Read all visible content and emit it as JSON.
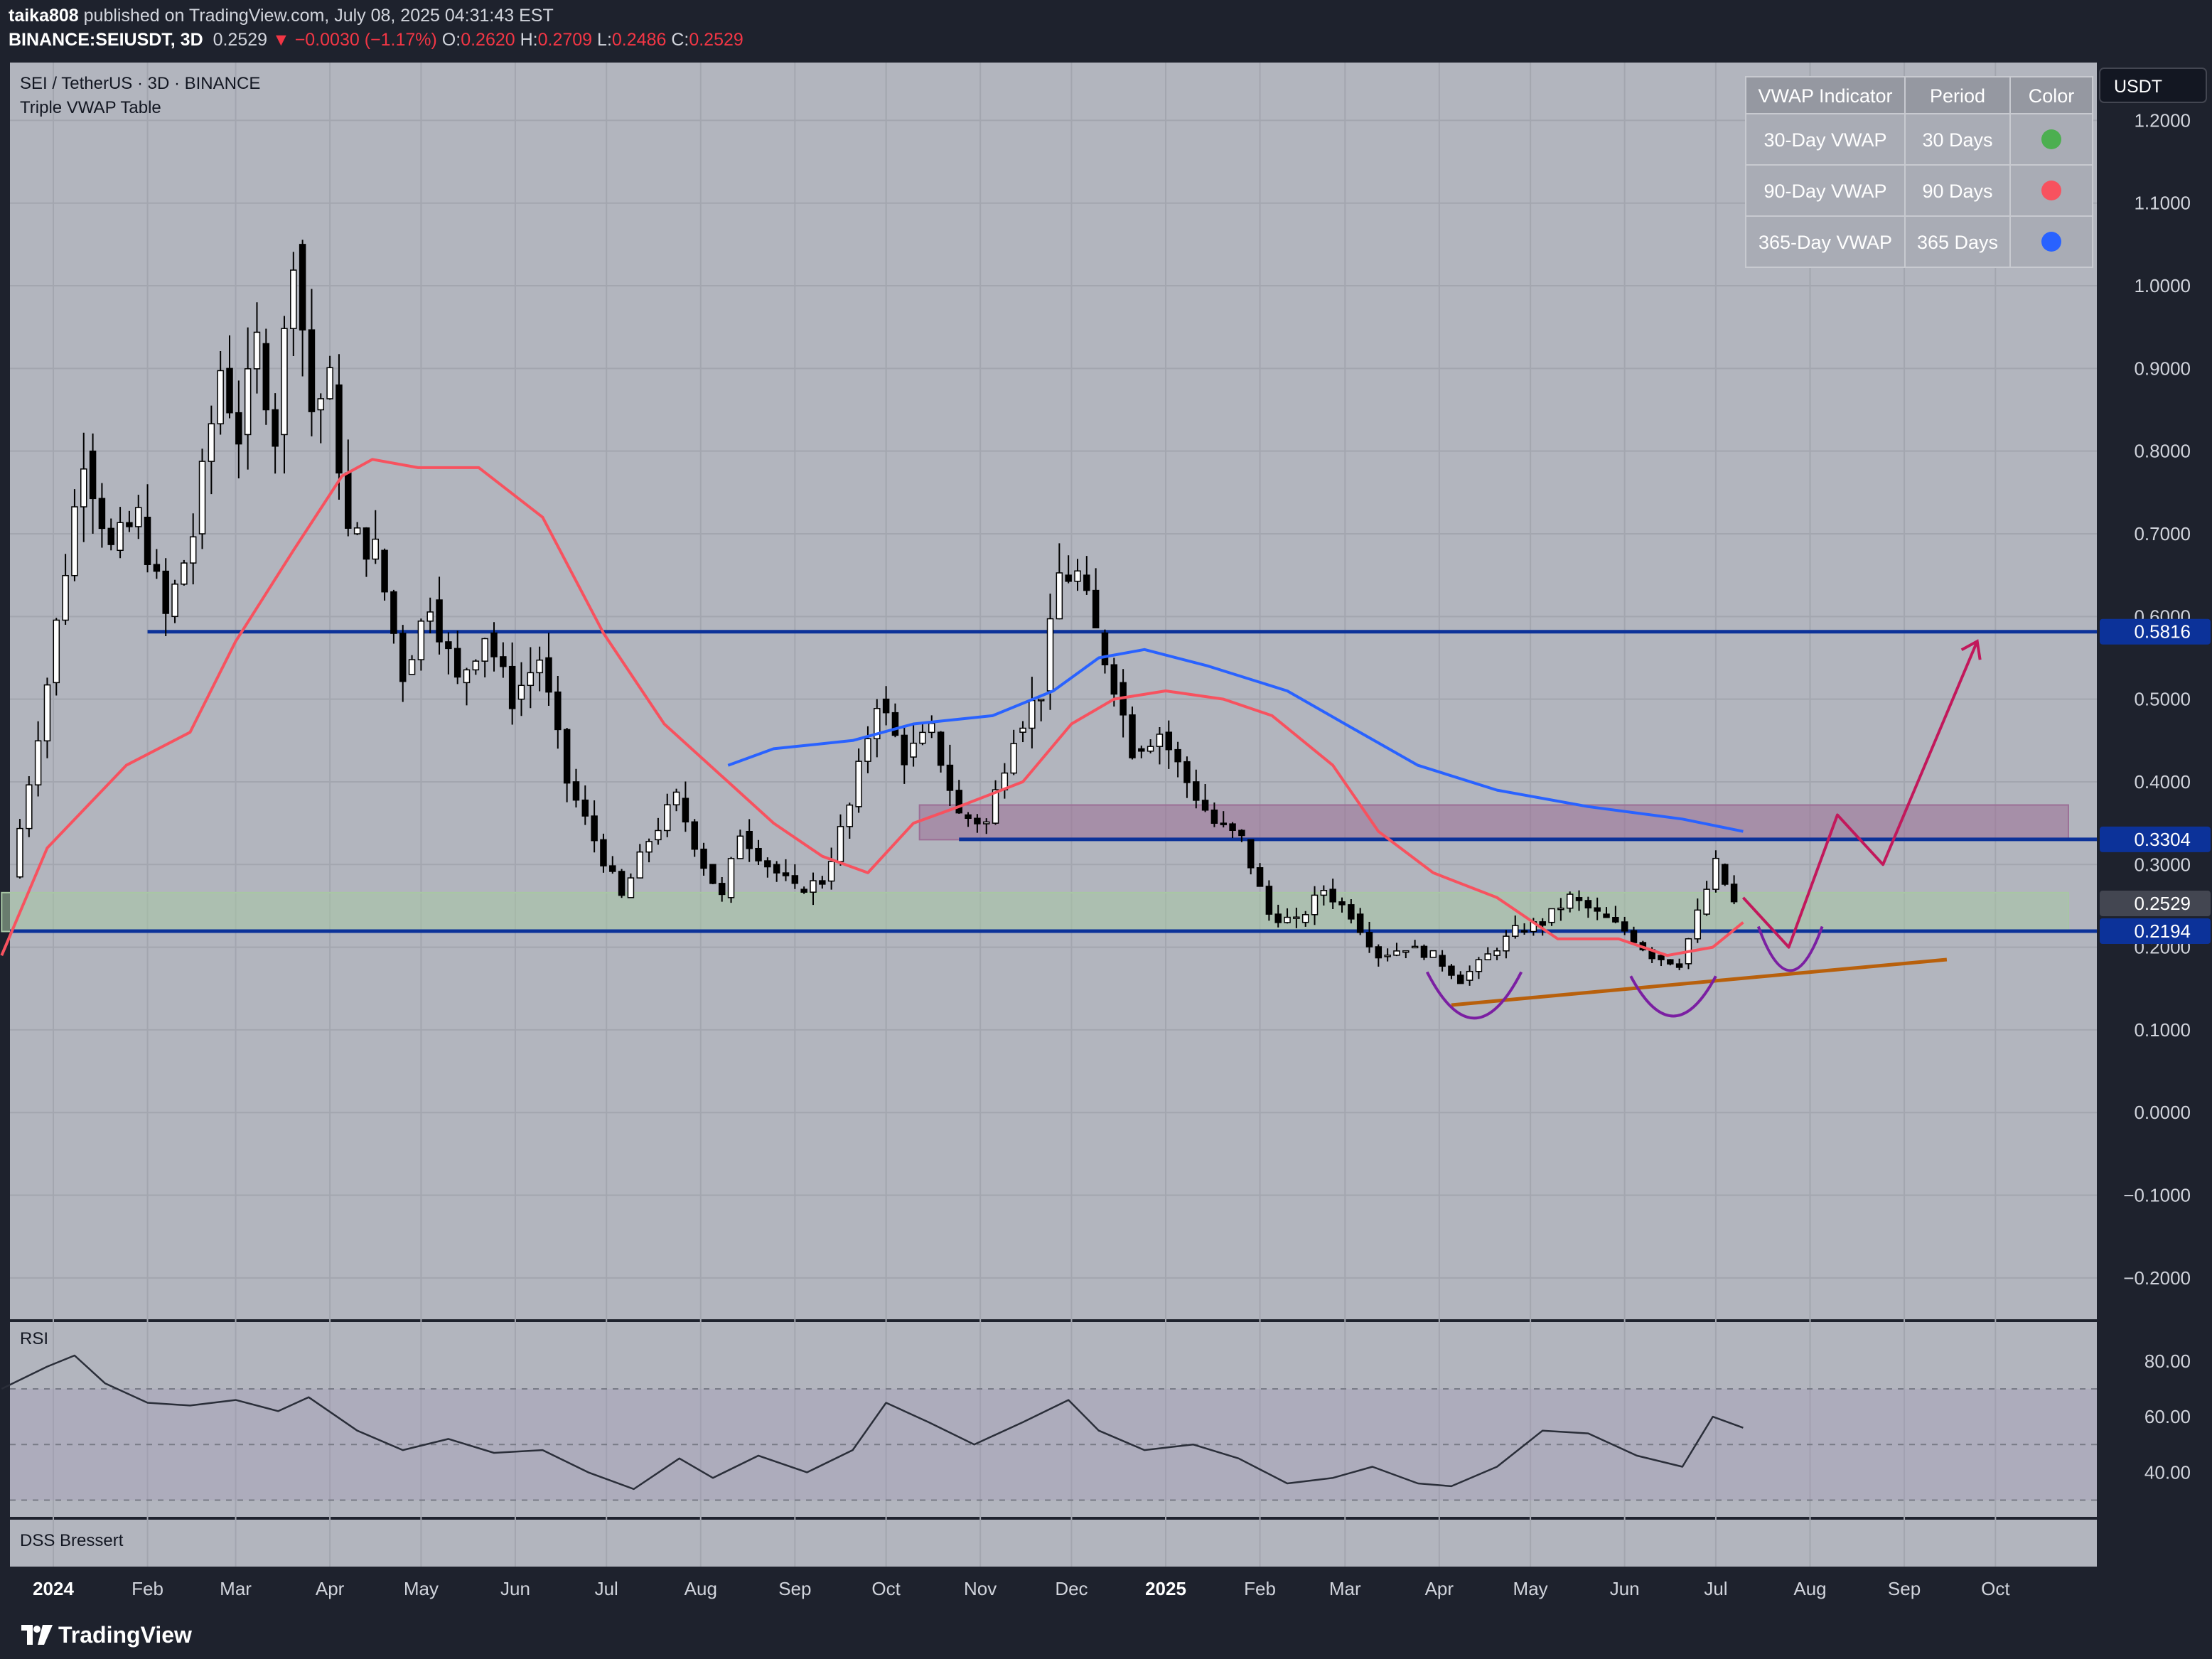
{
  "header": {
    "author": "taika808",
    "published_text": "published on TradingView.com, July 08, 2025 04:31:43 EST",
    "symbol": "BINANCE:SEIUSDT, 3D",
    "last": "0.2529",
    "change": "−0.0030 (−1.17%)",
    "o_label": "O:",
    "o_value": "0.2620",
    "h_label": "H:",
    "h_value": "0.2709",
    "l_label": "L:",
    "l_value": "0.2486",
    "c_label": "C:",
    "c_value": "0.2529"
  },
  "legend": {
    "symbol_title": "SEI / TetherUS · 3D · BINANCE",
    "indicator_title": "Triple VWAP Table",
    "rsi_title": "RSI",
    "dss_title": "DSS Bressert"
  },
  "vwap_table": {
    "headers": [
      "VWAP Indicator",
      "Period",
      "Color"
    ],
    "rows": [
      {
        "indicator": "30-Day VWAP",
        "period": "30 Days",
        "color": "#4caf50"
      },
      {
        "indicator": "90-Day VWAP",
        "period": "90 Days",
        "color": "#f7525f"
      },
      {
        "indicator": "365-Day VWAP",
        "period": "365 Days",
        "color": "#2962ff"
      }
    ]
  },
  "footer": {
    "brand": "TradingView"
  },
  "colors": {
    "pane_bg": "#b2b5be",
    "candle_body_up": "#ffffff",
    "candle_body_down": "#000000",
    "vwap90": "#f7525f",
    "vwap365": "#2962ff",
    "level_line": "#0c3299",
    "projection": "#c2185b",
    "cup": "#7b1fa2",
    "trendline": "#b8600c"
  },
  "chart_data": [
    {
      "type": "candlestick",
      "currency_label": "USDT",
      "y_ticks": [
        "1.2000",
        "1.1000",
        "1.0000",
        "0.9000",
        "0.8000",
        "0.7000",
        "0.6000",
        "0.5000",
        "0.4000",
        "0.3000",
        "0.2000",
        "0.1000",
        "0.0000",
        "−0.1000",
        "−0.2000"
      ],
      "y_range": [
        -0.25,
        1.27
      ],
      "x_labels": [
        "2024",
        "Feb",
        "Mar",
        "Apr",
        "May",
        "Jun",
        "Jul",
        "Aug",
        "Sep",
        "Oct",
        "Nov",
        "Dec",
        "2025",
        "Feb",
        "Mar",
        "Apr",
        "May",
        "Jun",
        "Jul",
        "Aug",
        "Sep",
        "Oct"
      ],
      "x_label_dates": [
        "2024-01-01",
        "2024-02-01",
        "2024-03-01",
        "2024-04-01",
        "2024-05-01",
        "2024-06-01",
        "2024-07-01",
        "2024-08-01",
        "2024-09-01",
        "2024-10-01",
        "2024-11-01",
        "2024-12-01",
        "2025-01-01",
        "2025-02-01",
        "2025-03-01",
        "2025-04-01",
        "2025-05-01",
        "2025-06-01",
        "2025-07-01",
        "2025-08-01",
        "2025-09-01",
        "2025-10-01"
      ],
      "bold_x_labels": [
        "2024",
        "2025"
      ],
      "price_badges": [
        {
          "value": 0.5816,
          "label": "0.5816"
        },
        {
          "value": 0.3304,
          "label": "0.3304"
        },
        {
          "value": 0.2529,
          "label": "0.2529"
        },
        {
          "value": 0.2194,
          "label": "0.2194"
        }
      ],
      "horizontal_levels": [
        {
          "value": 0.5816,
          "from": "2024-02-01",
          "to": "2025-10-25"
        },
        {
          "value": 0.3304,
          "from": "2024-10-25",
          "to": "2025-10-25"
        },
        {
          "value": 0.2194,
          "from": "2023-12-15",
          "to": "2025-10-25"
        }
      ],
      "zones": [
        {
          "name": "resistance-zone",
          "from": "2024-10-12",
          "to": "2025-10-25",
          "low": 0.33,
          "high": 0.372,
          "color": "#9c6f96"
        },
        {
          "name": "support-zone",
          "from": "2023-12-15",
          "to": "2025-10-25",
          "low": 0.219,
          "high": 0.266,
          "color": "#a8c7a4"
        }
      ],
      "ohlc_closes": [
        {
          "date": "2023-12-18",
          "close": 0.285
        },
        {
          "date": "2023-12-30",
          "close": 0.52
        },
        {
          "date": "2024-01-11",
          "close": 0.8
        },
        {
          "date": "2024-01-20",
          "close": 0.68
        },
        {
          "date": "2024-01-29",
          "close": 0.72
        },
        {
          "date": "2024-02-07",
          "close": 0.6
        },
        {
          "date": "2024-02-16",
          "close": 0.7
        },
        {
          "date": "2024-02-25",
          "close": 0.9
        },
        {
          "date": "2024-03-02",
          "close": 0.82
        },
        {
          "date": "2024-03-08",
          "close": 0.93
        },
        {
          "date": "2024-03-14",
          "close": 0.82
        },
        {
          "date": "2024-03-20",
          "close": 1.05
        },
        {
          "date": "2024-03-26",
          "close": 0.85
        },
        {
          "date": "2024-04-01",
          "close": 0.88
        },
        {
          "date": "2024-04-07",
          "close": 0.7
        },
        {
          "date": "2024-04-16",
          "close": 0.68
        },
        {
          "date": "2024-04-25",
          "close": 0.53
        },
        {
          "date": "2024-05-04",
          "close": 0.62
        },
        {
          "date": "2024-05-13",
          "close": 0.52
        },
        {
          "date": "2024-05-22",
          "close": 0.58
        },
        {
          "date": "2024-05-31",
          "close": 0.5
        },
        {
          "date": "2024-06-09",
          "close": 0.55
        },
        {
          "date": "2024-06-18",
          "close": 0.4
        },
        {
          "date": "2024-06-27",
          "close": 0.33
        },
        {
          "date": "2024-07-06",
          "close": 0.26
        },
        {
          "date": "2024-07-15",
          "close": 0.33
        },
        {
          "date": "2024-07-24",
          "close": 0.38
        },
        {
          "date": "2024-08-02",
          "close": 0.3
        },
        {
          "date": "2024-08-08",
          "close": 0.26
        },
        {
          "date": "2024-08-14",
          "close": 0.34
        },
        {
          "date": "2024-08-23",
          "close": 0.3
        },
        {
          "date": "2024-09-01",
          "close": 0.27
        },
        {
          "date": "2024-09-10",
          "close": 0.28
        },
        {
          "date": "2024-09-19",
          "close": 0.37
        },
        {
          "date": "2024-09-28",
          "close": 0.5
        },
        {
          "date": "2024-10-07",
          "close": 0.43
        },
        {
          "date": "2024-10-16",
          "close": 0.46
        },
        {
          "date": "2024-10-25",
          "close": 0.36
        },
        {
          "date": "2024-11-03",
          "close": 0.35
        },
        {
          "date": "2024-11-12",
          "close": 0.46
        },
        {
          "date": "2024-11-21",
          "close": 0.51
        },
        {
          "date": "2024-11-27",
          "close": 0.65
        },
        {
          "date": "2024-12-03",
          "close": 0.65
        },
        {
          "date": "2024-12-09",
          "close": 0.58
        },
        {
          "date": "2024-12-15",
          "close": 0.52
        },
        {
          "date": "2024-12-21",
          "close": 0.44
        },
        {
          "date": "2024-12-30",
          "close": 0.46
        },
        {
          "date": "2025-01-08",
          "close": 0.4
        },
        {
          "date": "2025-01-17",
          "close": 0.35
        },
        {
          "date": "2025-01-26",
          "close": 0.33
        },
        {
          "date": "2025-02-04",
          "close": 0.24
        },
        {
          "date": "2025-02-13",
          "close": 0.23
        },
        {
          "date": "2025-02-22",
          "close": 0.27
        },
        {
          "date": "2025-03-03",
          "close": 0.24
        },
        {
          "date": "2025-03-12",
          "close": 0.19
        },
        {
          "date": "2025-03-21",
          "close": 0.2
        },
        {
          "date": "2025-03-30",
          "close": 0.19
        },
        {
          "date": "2025-04-08",
          "close": 0.16
        },
        {
          "date": "2025-04-17",
          "close": 0.19
        },
        {
          "date": "2025-04-26",
          "close": 0.22
        },
        {
          "date": "2025-05-05",
          "close": 0.23
        },
        {
          "date": "2025-05-14",
          "close": 0.26
        },
        {
          "date": "2025-05-23",
          "close": 0.24
        },
        {
          "date": "2025-06-01",
          "close": 0.22
        },
        {
          "date": "2025-06-10",
          "close": 0.19
        },
        {
          "date": "2025-06-19",
          "close": 0.18
        },
        {
          "date": "2025-06-25",
          "close": 0.24
        },
        {
          "date": "2025-07-01",
          "close": 0.3
        },
        {
          "date": "2025-07-07",
          "close": 0.2529
        }
      ],
      "vwap_90": [
        {
          "date": "2023-12-15",
          "value": 0.19
        },
        {
          "date": "2023-12-30",
          "value": 0.32
        },
        {
          "date": "2024-01-25",
          "value": 0.42
        },
        {
          "date": "2024-02-15",
          "value": 0.46
        },
        {
          "date": "2024-03-01",
          "value": 0.57
        },
        {
          "date": "2024-03-20",
          "value": 0.68
        },
        {
          "date": "2024-04-05",
          "value": 0.77
        },
        {
          "date": "2024-04-15",
          "value": 0.79
        },
        {
          "date": "2024-04-30",
          "value": 0.78
        },
        {
          "date": "2024-05-20",
          "value": 0.78
        },
        {
          "date": "2024-06-10",
          "value": 0.72
        },
        {
          "date": "2024-06-30",
          "value": 0.58
        },
        {
          "date": "2024-07-20",
          "value": 0.47
        },
        {
          "date": "2024-08-10",
          "value": 0.4
        },
        {
          "date": "2024-08-25",
          "value": 0.35
        },
        {
          "date": "2024-09-10",
          "value": 0.31
        },
        {
          "date": "2024-09-25",
          "value": 0.29
        },
        {
          "date": "2024-10-10",
          "value": 0.35
        },
        {
          "date": "2024-10-25",
          "value": 0.37
        },
        {
          "date": "2024-11-15",
          "value": 0.4
        },
        {
          "date": "2024-12-01",
          "value": 0.47
        },
        {
          "date": "2024-12-15",
          "value": 0.5
        },
        {
          "date": "2025-01-01",
          "value": 0.51
        },
        {
          "date": "2025-01-20",
          "value": 0.5
        },
        {
          "date": "2025-02-05",
          "value": 0.48
        },
        {
          "date": "2025-02-25",
          "value": 0.42
        },
        {
          "date": "2025-03-12",
          "value": 0.34
        },
        {
          "date": "2025-03-30",
          "value": 0.29
        },
        {
          "date": "2025-04-20",
          "value": 0.26
        },
        {
          "date": "2025-05-10",
          "value": 0.21
        },
        {
          "date": "2025-05-30",
          "value": 0.21
        },
        {
          "date": "2025-06-15",
          "value": 0.19
        },
        {
          "date": "2025-06-30",
          "value": 0.2
        },
        {
          "date": "2025-07-10",
          "value": 0.23
        }
      ],
      "vwap_365": [
        {
          "date": "2024-08-10",
          "value": 0.42
        },
        {
          "date": "2024-08-25",
          "value": 0.44
        },
        {
          "date": "2024-09-20",
          "value": 0.45
        },
        {
          "date": "2024-10-10",
          "value": 0.47
        },
        {
          "date": "2024-11-05",
          "value": 0.48
        },
        {
          "date": "2024-11-25",
          "value": 0.51
        },
        {
          "date": "2024-12-10",
          "value": 0.55
        },
        {
          "date": "2024-12-25",
          "value": 0.56
        },
        {
          "date": "2025-01-15",
          "value": 0.54
        },
        {
          "date": "2025-02-10",
          "value": 0.51
        },
        {
          "date": "2025-03-01",
          "value": 0.47
        },
        {
          "date": "2025-03-25",
          "value": 0.42
        },
        {
          "date": "2025-04-20",
          "value": 0.39
        },
        {
          "date": "2025-05-20",
          "value": 0.37
        },
        {
          "date": "2025-06-20",
          "value": 0.355
        },
        {
          "date": "2025-07-10",
          "value": 0.34
        }
      ],
      "projection_path": [
        {
          "date": "2025-07-10",
          "value": 0.26
        },
        {
          "date": "2025-07-25",
          "value": 0.2
        },
        {
          "date": "2025-08-10",
          "value": 0.36
        },
        {
          "date": "2025-08-25",
          "value": 0.3
        },
        {
          "date": "2025-09-25",
          "value": 0.57
        }
      ],
      "trendline": [
        {
          "date": "2025-04-05",
          "value": 0.13
        },
        {
          "date": "2025-09-15",
          "value": 0.185
        }
      ]
    },
    {
      "type": "line",
      "title": "RSI",
      "y_ticks": [
        "80.00",
        "60.00",
        "40.00"
      ],
      "y_range": [
        24,
        94
      ],
      "bands": [
        70,
        50,
        30
      ],
      "points": [
        {
          "date": "2023-12-15",
          "value": 70
        },
        {
          "date": "2023-12-30",
          "value": 78
        },
        {
          "date": "2024-01-08",
          "value": 82
        },
        {
          "date": "2024-01-18",
          "value": 72
        },
        {
          "date": "2024-02-01",
          "value": 65
        },
        {
          "date": "2024-02-15",
          "value": 64
        },
        {
          "date": "2024-03-01",
          "value": 66
        },
        {
          "date": "2024-03-15",
          "value": 62
        },
        {
          "date": "2024-03-25",
          "value": 67
        },
        {
          "date": "2024-04-10",
          "value": 55
        },
        {
          "date": "2024-04-25",
          "value": 48
        },
        {
          "date": "2024-05-10",
          "value": 52
        },
        {
          "date": "2024-05-25",
          "value": 47
        },
        {
          "date": "2024-06-10",
          "value": 48
        },
        {
          "date": "2024-06-25",
          "value": 40
        },
        {
          "date": "2024-07-10",
          "value": 34
        },
        {
          "date": "2024-07-25",
          "value": 45
        },
        {
          "date": "2024-08-05",
          "value": 38
        },
        {
          "date": "2024-08-20",
          "value": 46
        },
        {
          "date": "2024-09-05",
          "value": 40
        },
        {
          "date": "2024-09-20",
          "value": 48
        },
        {
          "date": "2024-10-01",
          "value": 65
        },
        {
          "date": "2024-10-15",
          "value": 58
        },
        {
          "date": "2024-10-30",
          "value": 50
        },
        {
          "date": "2024-11-15",
          "value": 58
        },
        {
          "date": "2024-11-30",
          "value": 66
        },
        {
          "date": "2024-12-10",
          "value": 55
        },
        {
          "date": "2024-12-25",
          "value": 48
        },
        {
          "date": "2025-01-10",
          "value": 50
        },
        {
          "date": "2025-01-25",
          "value": 45
        },
        {
          "date": "2025-02-10",
          "value": 36
        },
        {
          "date": "2025-02-25",
          "value": 38
        },
        {
          "date": "2025-03-10",
          "value": 42
        },
        {
          "date": "2025-03-25",
          "value": 36
        },
        {
          "date": "2025-04-05",
          "value": 35
        },
        {
          "date": "2025-04-20",
          "value": 42
        },
        {
          "date": "2025-05-05",
          "value": 55
        },
        {
          "date": "2025-05-20",
          "value": 54
        },
        {
          "date": "2025-06-05",
          "value": 46
        },
        {
          "date": "2025-06-20",
          "value": 42
        },
        {
          "date": "2025-06-30",
          "value": 60
        },
        {
          "date": "2025-07-10",
          "value": 56
        }
      ]
    }
  ]
}
